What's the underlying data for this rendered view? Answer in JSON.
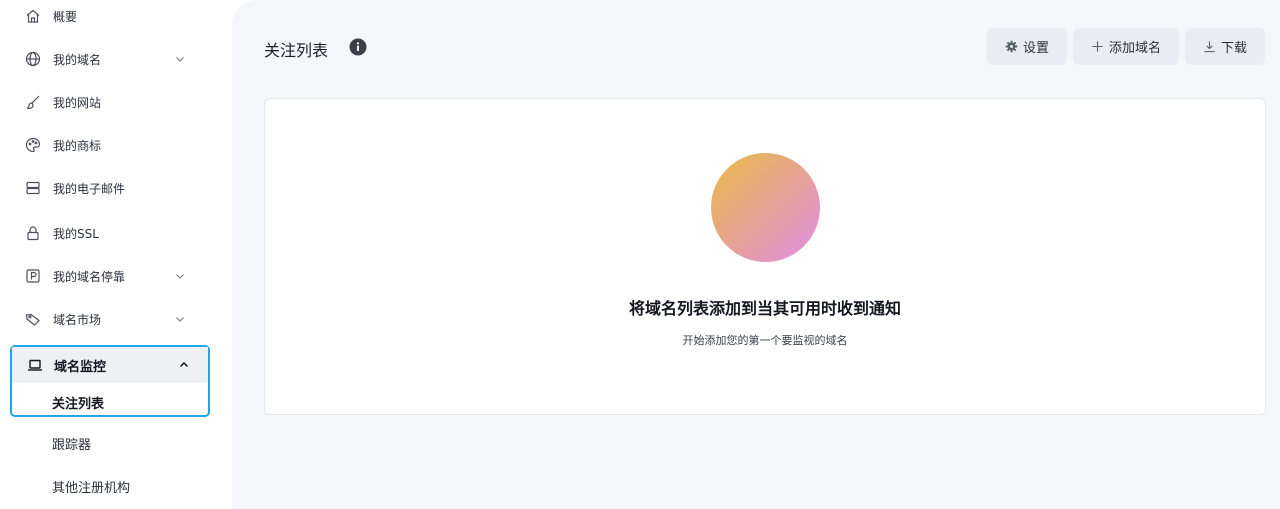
{
  "sidebar": {
    "items": [
      {
        "label": "概要",
        "icon": "home-icon"
      },
      {
        "label": "我的域名",
        "icon": "globe-icon"
      },
      {
        "label": "我的网站",
        "icon": "brush-icon"
      },
      {
        "label": "我的商标",
        "icon": "palette-icon"
      },
      {
        "label": "我的电子邮件",
        "icon": "server-icon"
      },
      {
        "label": "我的SSL",
        "icon": "lock-icon"
      },
      {
        "label": "我的域名停靠",
        "icon": "parking-icon"
      },
      {
        "label": "域名市场",
        "icon": "tag-icon"
      }
    ],
    "active_group": {
      "label": "域名监控",
      "icon": "laptop-icon",
      "children": [
        "关注列表",
        "跟踪器",
        "其他注册机构"
      ]
    }
  },
  "header": {
    "title": "关注列表",
    "info_icon": "info-icon",
    "buttons": {
      "settings": "设置",
      "add_domain": "添加域名",
      "download": "下载"
    }
  },
  "empty_state": {
    "title": "将域名列表添加到当其可用时收到通知",
    "subtitle": "开始添加您的第一个要监视的域名"
  },
  "colors": {
    "accent_border": "#1ea7e8",
    "main_bg": "#f4f6fa",
    "button_bg": "#e9edf3"
  }
}
